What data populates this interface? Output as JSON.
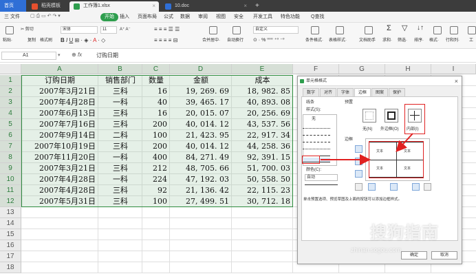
{
  "titlebar": {
    "home_tab": "首页",
    "tabs": [
      {
        "label": "稻壳模板"
      },
      {
        "label": "工作簿1.xlsx"
      },
      {
        "label": "10.doc"
      }
    ],
    "new_tab": "+"
  },
  "menubar": {
    "file": "三 文件",
    "items": [
      "开始",
      "插入",
      "页面布局",
      "公式",
      "数据",
      "审阅",
      "视图",
      "安全",
      "开发工具",
      "特色功能"
    ],
    "search": "Q查找"
  },
  "ribbon": {
    "cut": "✂ 剪切",
    "copy": "复制",
    "format_painter": "格式刷",
    "paste": "粘贴·",
    "font_name": "宋体",
    "font_size": "11",
    "merge_center": "合并居中·",
    "auto_wrap": "自动换行",
    "number_format": "自定义",
    "cond_format": "条件格式·",
    "table_style": "表格样式·",
    "doc_helper": "文档助手",
    "sum": "求和·",
    "filter": "筛选·",
    "sort": "排序·",
    "format": "格式·",
    "rows_cols": "行和列·",
    "worksheet": "工"
  },
  "formulabar": {
    "cell_ref": "A1",
    "fx": "fx",
    "value": "订购日期"
  },
  "columns": [
    "A",
    "B",
    "C",
    "D",
    "E",
    "F",
    "G",
    "H",
    "I"
  ],
  "rows": [
    "1",
    "2",
    "3",
    "4",
    "5",
    "6",
    "7",
    "8",
    "9",
    "10",
    "11",
    "12",
    "13",
    "14",
    "15",
    "16",
    "17",
    "18"
  ],
  "table": {
    "headers": [
      "订购日期",
      "销售部门",
      "数量",
      "金额",
      "成本"
    ],
    "rows": [
      [
        "2007年3月21日",
        "三科",
        "16",
        "19, 269. 69",
        "18, 982. 85"
      ],
      [
        "2007年4月28日",
        "一科",
        "40",
        "39, 465. 17",
        "40, 893. 08"
      ],
      [
        "2007年6月13日",
        "三科",
        "16",
        "20, 015. 07",
        "20, 256. 69"
      ],
      [
        "2007年7月16日",
        "三科",
        "200",
        "40, 014. 12",
        "43, 537. 56"
      ],
      [
        "2007年9月14日",
        "二科",
        "100",
        "21, 423. 95",
        "22, 917. 34"
      ],
      [
        "2007年10月19日",
        "三科",
        "200",
        "40, 014. 12",
        "44, 258. 36"
      ],
      [
        "2007年11月20日",
        "一科",
        "400",
        "84, 271. 49",
        "92, 391. 15"
      ],
      [
        "2007年3月21日",
        "三科",
        "212",
        "48, 705. 66",
        "51, 700. 03"
      ],
      [
        "2007年4月28日",
        "一科",
        "224",
        "47, 192. 03",
        "50, 558. 50"
      ],
      [
        "2007年4月28日",
        "三科",
        "92",
        "21, 136. 42",
        "22, 115. 23"
      ],
      [
        "2007年5月31日",
        "三科",
        "100",
        "27, 499. 51",
        "30, 712. 18"
      ]
    ]
  },
  "dialog": {
    "title": "单元格格式",
    "close": "×",
    "tabs": [
      "数字",
      "对齐",
      "字体",
      "边框",
      "图案",
      "保护"
    ],
    "active_tab": "边框",
    "line_group": "线条",
    "style_label": "样式(S):",
    "none_style": "无",
    "color_label": "颜色(C):",
    "color_value": "自动",
    "preset_group": "预置",
    "preset_none": "无(N)",
    "preset_outline": "外边框(O)",
    "preset_inside": "内部(I)",
    "border_group": "边框",
    "preview_text": [
      "文本",
      "文本",
      "文本",
      "文本"
    ],
    "hint": "单击预置选项、预览草图及上面的按钮可以添加边框样式。",
    "ok": "确定",
    "cancel": "取消"
  },
  "watermark": {
    "brand": "搜狗指南",
    "url": "zhinan.sogou.com"
  },
  "colors": {
    "selection_border": "#2e8b3e",
    "highlight_red": "#e02020",
    "start_button": "#2e9e4e",
    "home_tab": "#2f6fd6"
  }
}
